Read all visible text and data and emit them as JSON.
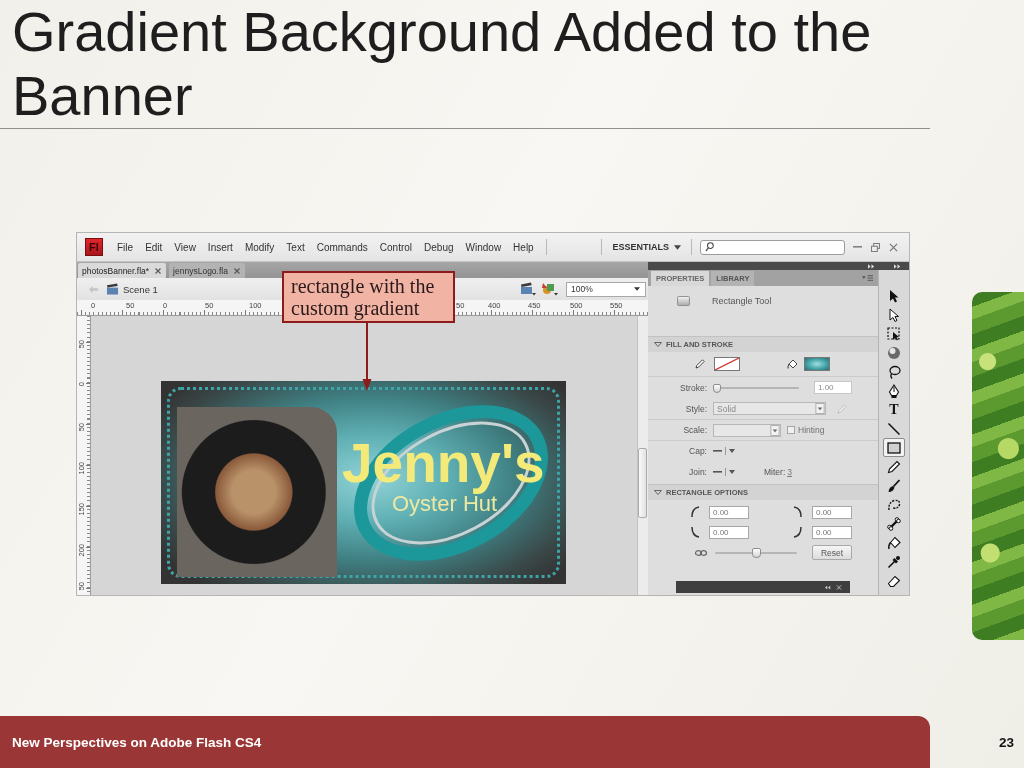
{
  "slide": {
    "title": "Gradient Background Added to the Banner",
    "footer": "New Perspectives on Adobe Flash CS4",
    "page_number": "23"
  },
  "app": {
    "logo": "Fl",
    "menu": [
      "File",
      "Edit",
      "View",
      "Insert",
      "Modify",
      "Text",
      "Commands",
      "Control",
      "Debug",
      "Window",
      "Help"
    ],
    "workspace": "ESSENTIALS",
    "documents": [
      {
        "label": "photosBanner.fla*",
        "selected": true
      },
      {
        "label": "jennysLogo.fla",
        "selected": false
      }
    ],
    "scene": "Scene 1",
    "zoom": "100%",
    "rulers": {
      "horizontal": [
        "0",
        "50",
        "0",
        "50",
        "100",
        "50",
        "400",
        "450",
        "500",
        "550"
      ],
      "vertical": [
        "50",
        "0",
        "50",
        "100",
        "150",
        "200",
        "50"
      ]
    },
    "callout": "rectangle with the custom gradient",
    "banner": {
      "title": "Jenny's",
      "subtitle": "Oyster Hut"
    },
    "properties": {
      "tabs": [
        {
          "label": "PROPERTIES",
          "selected": true
        },
        {
          "label": "LIBRARY",
          "selected": false
        }
      ],
      "tool_name": "Rectangle Tool",
      "fill_and_stroke": {
        "heading": "FILL AND STROKE",
        "expanded": true,
        "stroke_swatch": {
          "kind": "none"
        },
        "fill_swatch": {
          "kind": "gradient"
        },
        "stroke": {
          "label": "Stroke:",
          "value": "1.00",
          "level": 0,
          "disabled": true
        },
        "style": {
          "label": "Style:",
          "value": "Solid",
          "disabled": true
        },
        "scale": {
          "label": "Scale:",
          "disabled": true
        },
        "hinting": {
          "label": "Hinting",
          "checked": false,
          "disabled": true
        },
        "cap": {
          "label": "Cap:"
        },
        "join": {
          "label": "Join:"
        },
        "miter": {
          "label": "Miter:",
          "value": "3"
        }
      },
      "rectangle_options": {
        "heading": "RECTANGLE OPTIONS",
        "expanded": true,
        "corners": [
          "0.00",
          "0.00",
          "0.00",
          "0.00"
        ],
        "radius_slider": {
          "level": 0.5
        },
        "reset": "Reset"
      }
    },
    "tools": [
      {
        "kind": "selection",
        "selected": false
      },
      {
        "kind": "subselection",
        "selected": false
      },
      {
        "kind": "transform",
        "selected": false
      },
      {
        "kind": "rotation",
        "selected": false
      },
      {
        "kind": "lasso",
        "selected": false
      },
      {
        "kind": "pen",
        "selected": false
      },
      {
        "kind": "text",
        "label": "T",
        "selected": false
      },
      {
        "kind": "line",
        "selected": false
      },
      {
        "kind": "rectangle",
        "selected": true
      },
      {
        "kind": "pencil",
        "selected": false
      },
      {
        "kind": "brush",
        "selected": false
      },
      {
        "kind": "deco",
        "selected": false
      },
      {
        "kind": "bone",
        "selected": false
      },
      {
        "kind": "bucket",
        "selected": false
      },
      {
        "kind": "eyedropper",
        "selected": false
      },
      {
        "kind": "eraser",
        "selected": false
      }
    ]
  }
}
